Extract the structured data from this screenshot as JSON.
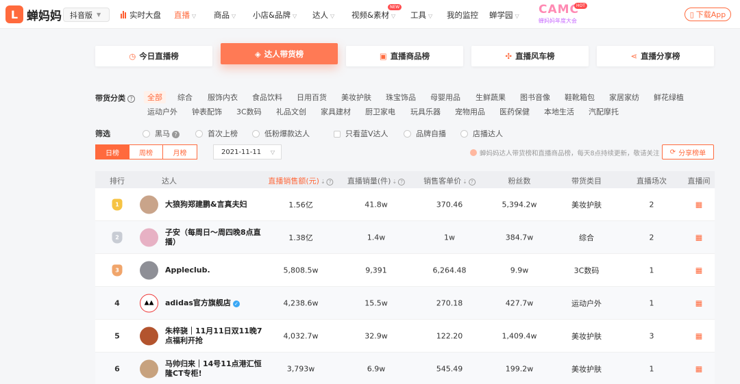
{
  "brand": {
    "logo_mark": "L",
    "name": "蝉妈妈",
    "version": "抖音版"
  },
  "nav": {
    "items": [
      "实时大盘",
      "直播",
      "商品",
      "小店&品牌",
      "达人",
      "视频&素材",
      "工具",
      "我的监控",
      "蝉学园"
    ],
    "new_badge": "NEW",
    "promo_logo": "CAMC",
    "promo_hot": "HOT",
    "promo_sub": "蝉妈妈年度大会",
    "download": "下载App"
  },
  "rank_tabs": [
    "今日直播榜",
    "达人带货榜",
    "直播商品榜",
    "直播风车榜",
    "直播分享榜"
  ],
  "active_rank_tab": 1,
  "category": {
    "label": "带货分类",
    "row1": [
      "全部",
      "综合",
      "服饰内衣",
      "食品饮料",
      "日用百货",
      "美妆护肤",
      "珠宝饰品",
      "母婴用品",
      "生鲜蔬果",
      "图书音像",
      "鞋靴箱包",
      "家居家纺",
      "鲜花绿植"
    ],
    "row2": [
      "运动户外",
      "钟表配饰",
      "3C数码",
      "礼品文创",
      "家具建材",
      "厨卫家电",
      "玩具乐器",
      "宠物用品",
      "医药保健",
      "本地生活",
      "汽配摩托"
    ]
  },
  "screen": {
    "label": "筛选",
    "options": [
      "黑马",
      "首次上榜",
      "低粉爆款达人",
      "只看蓝V达人",
      "品牌自播",
      "店播达人"
    ]
  },
  "period": {
    "options": [
      "日榜",
      "周榜",
      "月榜"
    ],
    "date": "2021-11-11"
  },
  "notice": "蝉妈妈达人带货榜和直播商品榜，每天8点持续更新，敬请关注",
  "share_button": "分享榜单",
  "table": {
    "headers": [
      "排行",
      "达人",
      "直播销售额(元)",
      "直播销量(件)",
      "销售客单价",
      "粉丝数",
      "带货类目",
      "直播场次",
      "直播间"
    ],
    "rows": [
      {
        "rank": "1",
        "name": "大狼狗郑建鹏&言真夫妇",
        "verified": false,
        "sales": "1.56亿",
        "volume": "41.8w",
        "unit_price": "370.46",
        "fans": "5,394.2w",
        "category": "美妆护肤",
        "sessions": "2"
      },
      {
        "rank": "2",
        "name": "子安（每周日～周四晚8点直播）",
        "verified": false,
        "sales": "1.38亿",
        "volume": "1.4w",
        "unit_price": "1w",
        "fans": "384.7w",
        "category": "综合",
        "sessions": "2"
      },
      {
        "rank": "3",
        "name": "Appleclub.",
        "verified": false,
        "sales": "5,808.5w",
        "volume": "9,391",
        "unit_price": "6,264.48",
        "fans": "9.9w",
        "category": "3C数码",
        "sessions": "1"
      },
      {
        "rank": "4",
        "name": "adidas官方旗舰店",
        "verified": true,
        "sales": "4,238.6w",
        "volume": "15.5w",
        "unit_price": "270.18",
        "fans": "427.7w",
        "category": "运动户外",
        "sessions": "1"
      },
      {
        "rank": "5",
        "name": "朱梓骁｜11月11日双11晚7点福利开抢",
        "verified": false,
        "sales": "4,032.7w",
        "volume": "32.9w",
        "unit_price": "122.20",
        "fans": "1,409.4w",
        "category": "美妆护肤",
        "sessions": "3"
      },
      {
        "rank": "6",
        "name": "马帅归来｜14号11点港汇恒隆CT专柜!",
        "verified": false,
        "sales": "3,793w",
        "volume": "6.9w",
        "unit_price": "545.49",
        "fans": "199.2w",
        "category": "美妆护肤",
        "sessions": "1"
      }
    ]
  },
  "colors": {
    "accent": "#ff6a3d",
    "gold": "#f6c343",
    "silver": "#c8ccd4",
    "bronze": "#f0a56b"
  }
}
